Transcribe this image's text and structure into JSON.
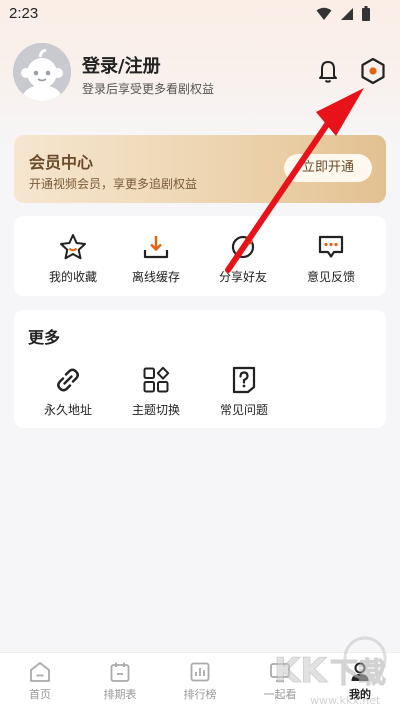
{
  "status_bar": {
    "time": "2:23",
    "icons": [
      "wifi-icon",
      "signal-icon",
      "battery-icon"
    ]
  },
  "profile": {
    "title": "登录/注册",
    "subtitle": "登录后享受更多看剧权益",
    "icons": [
      "avatar",
      "bell-icon",
      "settings-hex-icon"
    ]
  },
  "vip": {
    "title": "会员中心",
    "subtitle": "开通视频会员，享更多追剧权益",
    "button": "立即开通"
  },
  "features": [
    {
      "label": "我的收藏",
      "icon": "star-icon"
    },
    {
      "label": "离线缓存",
      "icon": "download-icon"
    },
    {
      "label": "分享好友",
      "icon": "share-icon"
    },
    {
      "label": "意见反馈",
      "icon": "feedback-icon"
    }
  ],
  "more": {
    "title": "更多",
    "items": [
      {
        "label": "永久地址",
        "icon": "link-icon"
      },
      {
        "label": "主题切换",
        "icon": "theme-grid-icon"
      },
      {
        "label": "常见问题",
        "icon": "faq-icon"
      }
    ]
  },
  "bottom_nav": [
    {
      "label": "首页",
      "icon": "home-icon",
      "active": false
    },
    {
      "label": "排期表",
      "icon": "calendar-icon",
      "active": false
    },
    {
      "label": "排行榜",
      "icon": "chart-icon",
      "active": false
    },
    {
      "label": "一起看",
      "icon": "watch-together-icon",
      "active": false
    },
    {
      "label": "我的",
      "icon": "profile-icon",
      "active": true
    }
  ],
  "watermark": {
    "text": "KK下载",
    "url": "www.kkx.net"
  },
  "colors": {
    "accent": "#e8610f",
    "vip_gold": "#e2c191",
    "arrow": "#e8121a"
  }
}
